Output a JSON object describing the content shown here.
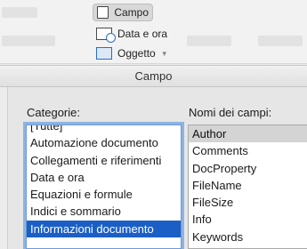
{
  "ribbon": {
    "campo_label": "Campo",
    "data_ora_label": "Data e ora",
    "oggetto_label": "Oggetto"
  },
  "dialog": {
    "title": "Campo",
    "categorie_label": "Categorie:",
    "nomi_label": "Nomi dei campi:",
    "categorie": [
      "[Tutte]",
      "Automazione documento",
      "Collegamenti e riferimenti",
      "Data e ora",
      "Equazioni e formule",
      "Indici e sommario",
      "Informazioni documento"
    ],
    "selected_category": "Informazioni documento",
    "nomi_campi": [
      "Author",
      "Comments",
      "DocProperty",
      "FileName",
      "FileSize",
      "Info",
      "Keywords"
    ],
    "selected_field": "Author"
  },
  "colors": {
    "selection_blue": "#1b5fc6",
    "focus_ring": "#8db3e2"
  }
}
